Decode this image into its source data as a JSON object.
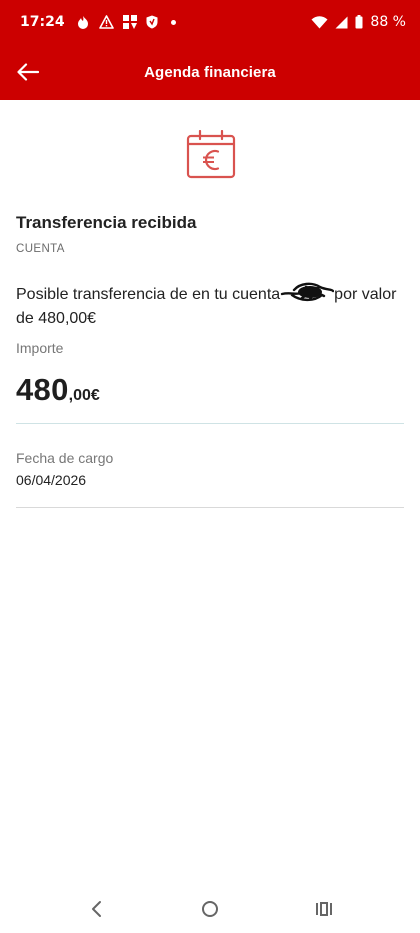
{
  "status_bar": {
    "time": "17:24",
    "battery": "88 %",
    "icons": [
      "fire-icon",
      "warning-icon",
      "apps-grid-icon",
      "shield-icon",
      "notification-dot",
      "wifi-icon",
      "signal-icon",
      "battery-icon"
    ]
  },
  "app_bar": {
    "title": "Agenda financiera",
    "back_icon": "arrow-left-icon"
  },
  "transaction": {
    "icon": "euro-calendar-icon",
    "title": "Transferencia recibida",
    "account_label": "CUENTA",
    "description_part1": "Posible transferencia de  en tu cuenta",
    "description_part2": "por valor de 480,00€",
    "amount_label": "Importe",
    "amount_integer": "480",
    "amount_decimal": ",00€",
    "date_label": "Fecha de cargo",
    "date_value": "06/04/2026"
  },
  "colors": {
    "brand": "#cc0000",
    "icon": "#d9534f",
    "divider_accent": "#cfe3e5"
  },
  "nav_bar": {
    "icons": [
      "back-nav-icon",
      "home-nav-icon",
      "recents-nav-icon"
    ]
  }
}
